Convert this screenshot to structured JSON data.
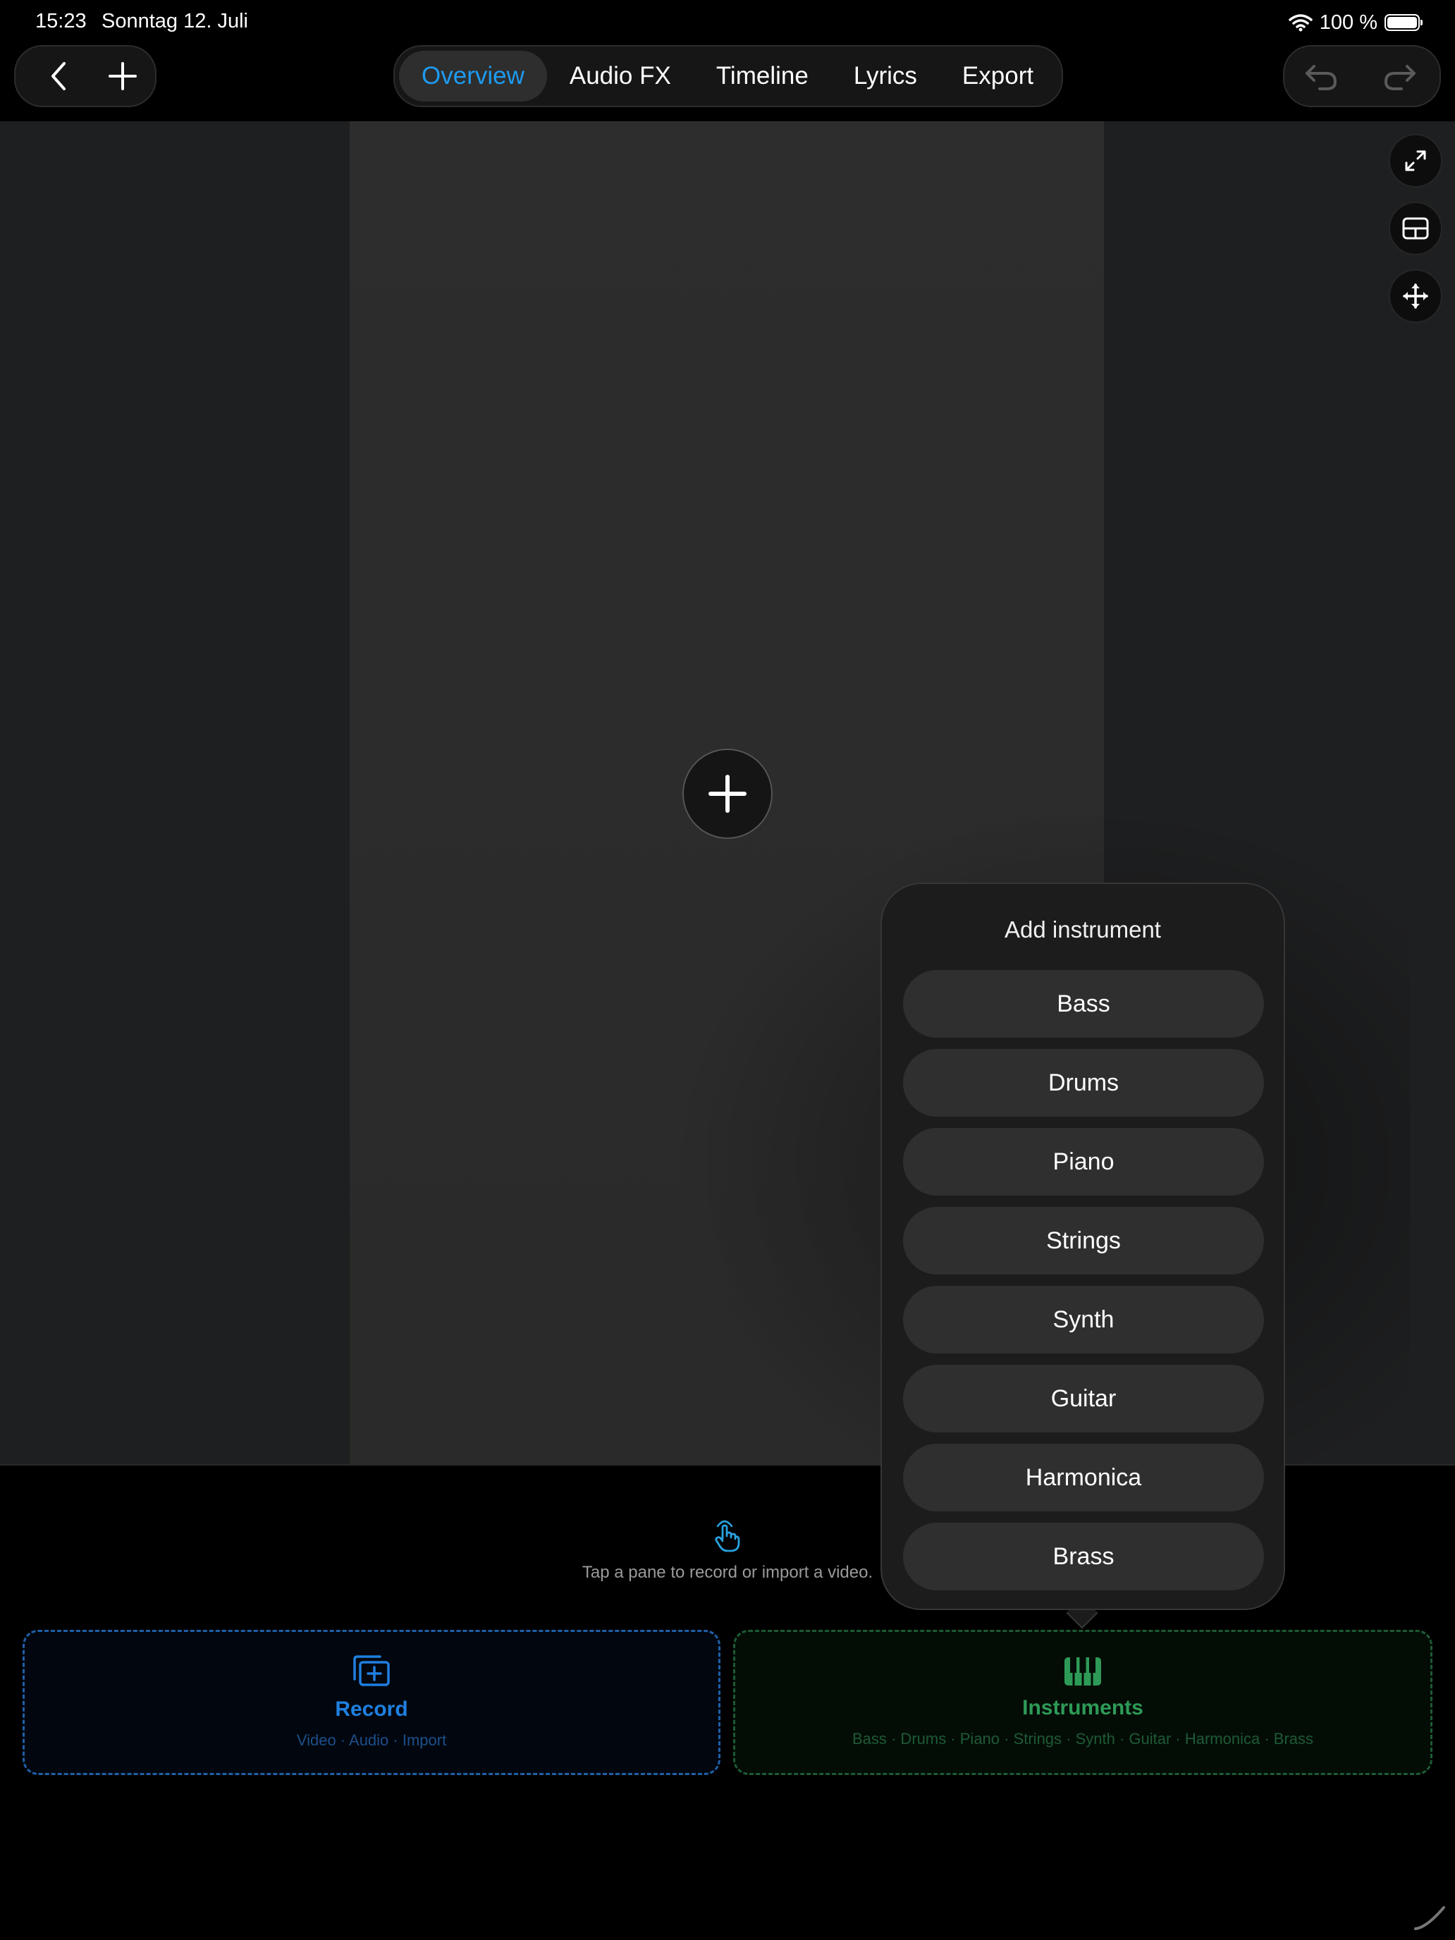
{
  "status_bar": {
    "time": "15:23",
    "date": "Sonntag 12. Juli",
    "battery": "100 %"
  },
  "tabs": [
    {
      "label": "Overview",
      "active": true
    },
    {
      "label": "Audio FX",
      "active": false
    },
    {
      "label": "Timeline",
      "active": false
    },
    {
      "label": "Lyrics",
      "active": false
    },
    {
      "label": "Export",
      "active": false
    }
  ],
  "icons": {
    "back": "chevron-left-icon",
    "add": "plus-icon",
    "undo": "undo-icon",
    "redo": "redo-icon",
    "expand": "expand-icon",
    "grid": "grid-layout-icon",
    "move": "move-arrows-icon",
    "add_pane": "plus-icon",
    "hint": "tap-hand-icon",
    "record": "add-media-icon",
    "instruments": "piano-icon"
  },
  "hint": {
    "text": "Tap a pane to record or import a video."
  },
  "record_card": {
    "title": "Record",
    "subtitle": "Video · Audio · Import"
  },
  "instruments_card": {
    "title": "Instruments",
    "subtitle": "Bass · Drums · Piano · Strings · Synth · Guitar · Harmonica · Brass"
  },
  "popup": {
    "title": "Add instrument",
    "items": [
      "Bass",
      "Drums",
      "Piano",
      "Strings",
      "Synth",
      "Guitar",
      "Harmonica",
      "Brass"
    ]
  },
  "colors": {
    "accent_blue": "#1d9bf0",
    "record_blue": "#1f7fe0",
    "instrument_green": "#2e9a57"
  }
}
